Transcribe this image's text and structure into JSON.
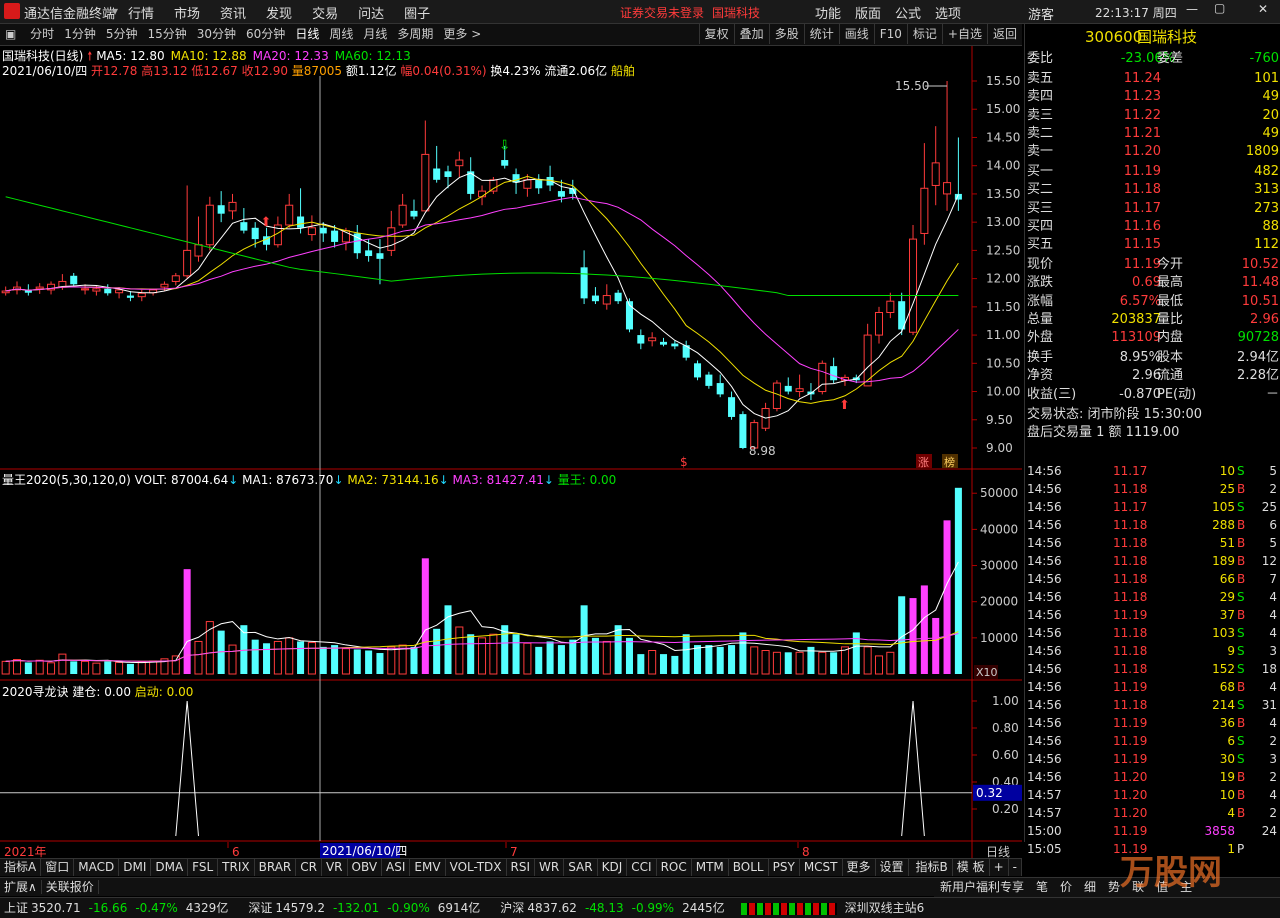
{
  "app": {
    "title": "通达信金融终端",
    "menu": [
      "行情",
      "市场",
      "资讯",
      "发现",
      "交易",
      "问达",
      "圈子"
    ],
    "notice": "证券交易未登录",
    "stock_short": "国瑞科技",
    "right_menu": [
      "功能",
      "版面",
      "公式",
      "选项"
    ],
    "user": "游客",
    "clock": "22:13:17 周四"
  },
  "toolbar": {
    "periods": [
      "分时",
      "1分钟",
      "5分钟",
      "15分钟",
      "30分钟",
      "60分钟",
      "日线",
      "周线",
      "月线",
      "多周期",
      "更多 >"
    ],
    "active": "日线",
    "right": [
      "复权",
      "叠加",
      "多股",
      "统计",
      "画线",
      "F10",
      "标记",
      "+自选",
      "返回"
    ]
  },
  "chart": {
    "title": "国瑞科技(日线)",
    "ma": [
      {
        "label": "MA5: 12.80",
        "color": "#ffffff"
      },
      {
        "label": "MA10: 12.88",
        "color": "#f0e000"
      },
      {
        "label": "MA20: 12.33",
        "color": "#ff40ff"
      },
      {
        "label": "MA60: 12.13",
        "color": "#00e000"
      }
    ],
    "info": {
      "date": "2021/06/10/四",
      "open": "开12.78",
      "high": "高13.12",
      "low": "低12.67",
      "close": "收12.90",
      "vol": "量87005",
      "amt": "额1.12亿",
      "amp": "幅0.04(0.31%)",
      "turn": "换4.23%",
      "float": "流通2.06亿",
      "sector": "船舶"
    },
    "y_ticks": [
      "15.50",
      "15.00",
      "14.50",
      "14.00",
      "13.50",
      "13.00",
      "12.50",
      "12.00",
      "11.50",
      "11.00",
      "10.50",
      "10.00",
      "9.50",
      "9.00"
    ],
    "hi_label": "15.50",
    "lo_label": "8.98",
    "marks": [
      "$",
      "涨",
      "榜"
    ]
  },
  "volume": {
    "title": "量王2020(5,30,120,0)",
    "volt": "VOLT: 87004.64",
    "ma1": "MA1: 87673.70",
    "ma2": "MA2: 73144.16",
    "ma3": "MA3: 81427.41",
    "king": "量王: 0.00",
    "y_ticks": [
      "50000",
      "40000",
      "30000",
      "20000",
      "10000"
    ],
    "unit": "X10"
  },
  "indicator": {
    "title": "2020寻龙诀",
    "jc": "建仓: 0.00",
    "qd": "启动: 0.00",
    "y_ticks": [
      "1.00",
      "0.80",
      "0.60",
      "0.40",
      "0.20"
    ],
    "cursor_val": "0.32"
  },
  "x_axis": {
    "labels": [
      "2021年",
      "6",
      "7",
      "8"
    ],
    "cursor_date": "2021/06/10/四",
    "period": "日线"
  },
  "quote": {
    "code": "300600",
    "name": "国瑞科技",
    "wb_label": "委比",
    "wb": "-23.06%",
    "wc_label": "委差",
    "wc": "-760",
    "asks": [
      {
        "name": "卖五",
        "price": "11.24",
        "vol": "101"
      },
      {
        "name": "卖四",
        "price": "11.23",
        "vol": "49"
      },
      {
        "name": "卖三",
        "price": "11.22",
        "vol": "20"
      },
      {
        "name": "卖二",
        "price": "11.21",
        "vol": "49"
      },
      {
        "name": "卖一",
        "price": "11.20",
        "vol": "1809"
      }
    ],
    "bids": [
      {
        "name": "买一",
        "price": "11.19",
        "vol": "482"
      },
      {
        "name": "买二",
        "price": "11.18",
        "vol": "313"
      },
      {
        "name": "买三",
        "price": "11.17",
        "vol": "273"
      },
      {
        "name": "买四",
        "price": "11.16",
        "vol": "88"
      },
      {
        "name": "买五",
        "price": "11.15",
        "vol": "112"
      }
    ],
    "stats": [
      [
        "现价",
        "11.19",
        "今开",
        "10.52"
      ],
      [
        "涨跌",
        "0.69",
        "最高",
        "11.48"
      ],
      [
        "涨幅",
        "6.57%",
        "最低",
        "10.51"
      ],
      [
        "总量",
        "203837",
        "量比",
        "2.96"
      ],
      [
        "外盘",
        "113109",
        "内盘",
        "90728"
      ],
      [
        "换手",
        "8.95%",
        "股本",
        "2.94亿"
      ],
      [
        "净资",
        "2.96",
        "流通",
        "2.28亿"
      ],
      [
        "收益(三)",
        "-0.870",
        "PE(动)",
        "－"
      ]
    ],
    "status": "交易状态: 闭市阶段 15:30:00",
    "after": "盘后交易量 1 额 1119.00"
  },
  "ticks": [
    [
      "14:56",
      "11.17",
      "10",
      "S",
      "5"
    ],
    [
      "14:56",
      "11.18",
      "25",
      "B",
      "2"
    ],
    [
      "14:56",
      "11.17",
      "105",
      "S",
      "25"
    ],
    [
      "14:56",
      "11.18",
      "288",
      "B",
      "6"
    ],
    [
      "14:56",
      "11.18",
      "51",
      "B",
      "5"
    ],
    [
      "14:56",
      "11.18",
      "189",
      "B",
      "12"
    ],
    [
      "14:56",
      "11.18",
      "66",
      "B",
      "7"
    ],
    [
      "14:56",
      "11.18",
      "29",
      "S",
      "4"
    ],
    [
      "14:56",
      "11.19",
      "37",
      "B",
      "4"
    ],
    [
      "14:56",
      "11.18",
      "103",
      "S",
      "4"
    ],
    [
      "14:56",
      "11.18",
      "9",
      "S",
      "3"
    ],
    [
      "14:56",
      "11.18",
      "152",
      "S",
      "18"
    ],
    [
      "14:56",
      "11.19",
      "68",
      "B",
      "4"
    ],
    [
      "14:56",
      "11.18",
      "214",
      "S",
      "31"
    ],
    [
      "14:56",
      "11.19",
      "36",
      "B",
      "4"
    ],
    [
      "14:56",
      "11.19",
      "6",
      "S",
      "2"
    ],
    [
      "14:56",
      "11.19",
      "30",
      "S",
      "3"
    ],
    [
      "14:56",
      "11.20",
      "19",
      "B",
      "2"
    ],
    [
      "14:57",
      "11.20",
      "10",
      "B",
      "4"
    ],
    [
      "14:57",
      "11.20",
      "4",
      "B",
      "2"
    ],
    [
      "15:00",
      "11.19",
      "3858",
      "",
      "24"
    ],
    [
      "15:05",
      "11.19",
      "1",
      "P",
      ""
    ]
  ],
  "tabs": [
    "指标A",
    "窗口",
    "MACD",
    "DMI",
    "DMA",
    "FSL",
    "TRIX",
    "BRAR",
    "CR",
    "VR",
    "OBV",
    "ASI",
    "EMV",
    "VOL-TDX",
    "RSI",
    "WR",
    "SAR",
    "KDJ",
    "CCI",
    "ROC",
    "MTM",
    "BOLL",
    "PSY",
    "MCST",
    "更多",
    "设置"
  ],
  "tabs_right": [
    "指标B",
    "模 板",
    "+",
    "-"
  ],
  "bottom2": [
    "扩展∧",
    "关联报价"
  ],
  "rp_bottom": [
    "新用户福利专享",
    "笔",
    "价",
    "细",
    "势",
    "联",
    "值",
    "主"
  ],
  "status": {
    "sh": [
      "上证",
      "3520.71",
      "-16.66",
      "-0.47%",
      "4329亿"
    ],
    "sz": [
      "深证",
      "14579.2",
      "-132.01",
      "-0.90%",
      "6914亿"
    ],
    "hs": [
      "沪深",
      "4837.62",
      "-48.13",
      "-0.99%",
      "2445亿"
    ],
    "server": "深圳双线主站6"
  },
  "watermark": "万股网",
  "colors": {
    "up": "#ff3b3b",
    "down": "#54ffff",
    "ma5": "#ffffff",
    "ma10": "#f0e000",
    "ma20": "#ff40ff",
    "ma60": "#00e000",
    "volup": "#ff40ff"
  }
}
